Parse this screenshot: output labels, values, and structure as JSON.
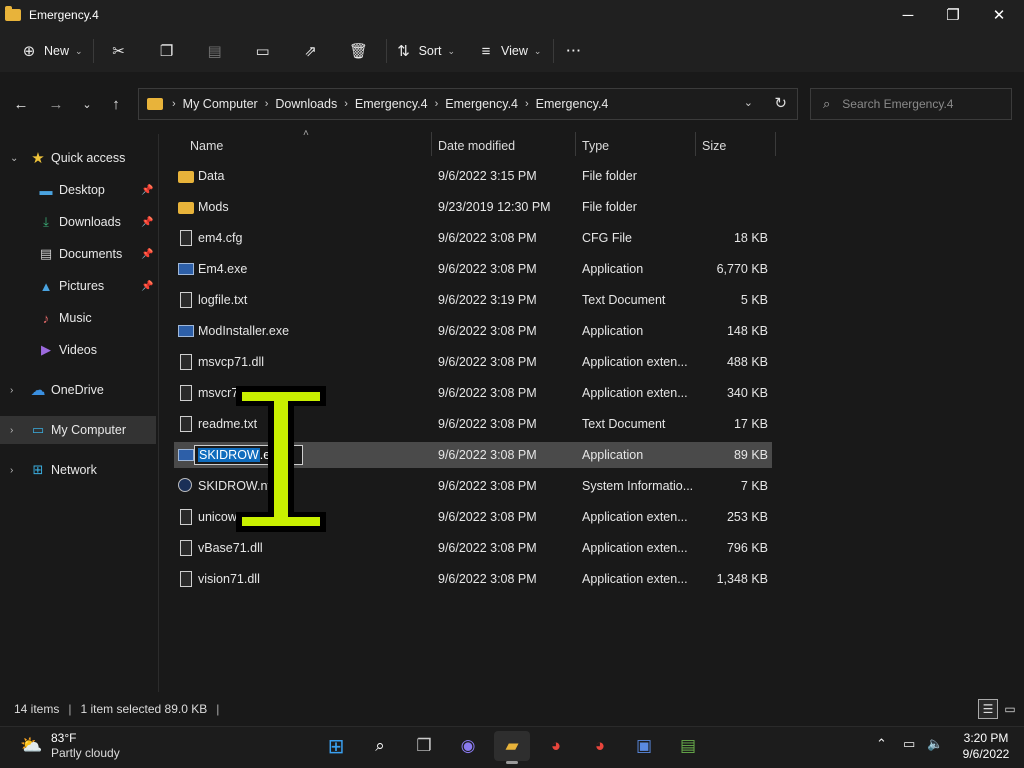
{
  "window": {
    "title": "Emergency.4",
    "controls": {
      "minimize": "─",
      "maximize": "❐",
      "close": "✕"
    }
  },
  "toolbar": {
    "new_label": "New",
    "sort_label": "Sort",
    "view_label": "View",
    "more_label": "···",
    "icons": [
      "cut-icon",
      "copy-icon",
      "paste-icon",
      "rename-icon",
      "share-icon",
      "delete-icon"
    ]
  },
  "address": {
    "breadcrumbs": [
      "My Computer",
      "Downloads",
      "Emergency.4",
      "Emergency.4",
      "Emergency.4"
    ],
    "search_placeholder": "Search Emergency.4"
  },
  "sidebar": {
    "quick_access": "Quick access",
    "quick_items": [
      {
        "label": "Desktop",
        "icon": "desktop-icon"
      },
      {
        "label": "Downloads",
        "icon": "download-icon"
      },
      {
        "label": "Documents",
        "icon": "documents-icon"
      },
      {
        "label": "Pictures",
        "icon": "pictures-icon"
      },
      {
        "label": "Music",
        "icon": "music-icon"
      },
      {
        "label": "Videos",
        "icon": "videos-icon"
      }
    ],
    "onedrive": "OneDrive",
    "mycomputer": "My Computer",
    "network": "Network"
  },
  "columns": {
    "name": "Name",
    "date": "Date modified",
    "type": "Type",
    "size": "Size"
  },
  "files": [
    {
      "name": "Data",
      "date": "9/6/2022 3:15 PM",
      "type": "File folder",
      "size": "",
      "icon": "folder"
    },
    {
      "name": "Mods",
      "date": "9/23/2019 12:30 PM",
      "type": "File folder",
      "size": "",
      "icon": "folder"
    },
    {
      "name": "em4.cfg",
      "date": "9/6/2022 3:08 PM",
      "type": "CFG File",
      "size": "18 KB",
      "icon": "doc"
    },
    {
      "name": "Em4.exe",
      "date": "9/6/2022 3:08 PM",
      "type": "Application",
      "size": "6,770 KB",
      "icon": "app"
    },
    {
      "name": "logfile.txt",
      "date": "9/6/2022 3:19 PM",
      "type": "Text Document",
      "size": "5 KB",
      "icon": "doc"
    },
    {
      "name": "ModInstaller.exe",
      "date": "9/6/2022 3:08 PM",
      "type": "Application",
      "size": "148 KB",
      "icon": "app"
    },
    {
      "name": "msvcp71.dll",
      "date": "9/6/2022 3:08 PM",
      "type": "Application exten...",
      "size": "488 KB",
      "icon": "dll"
    },
    {
      "name": "msvcr7",
      "date": "9/6/2022 3:08 PM",
      "type": "Application exten...",
      "size": "340 KB",
      "icon": "dll"
    },
    {
      "name": "readme.txt",
      "date": "9/6/2022 3:08 PM",
      "type": "Text Document",
      "size": "17 KB",
      "icon": "doc"
    },
    {
      "name": "",
      "date": "9/6/2022 3:08 PM",
      "type": "Application",
      "size": "89 KB",
      "icon": "app"
    },
    {
      "name": "SKIDROW.nfo",
      "date": "9/6/2022 3:08 PM",
      "type": "System Informatio...",
      "size": "7 KB",
      "icon": "nfo"
    },
    {
      "name": "unicow",
      "date": "9/6/2022 3:08 PM",
      "type": "Application exten...",
      "size": "253 KB",
      "icon": "dll"
    },
    {
      "name": "vBase71.dll",
      "date": "9/6/2022 3:08 PM",
      "type": "Application exten...",
      "size": "796 KB",
      "icon": "dll"
    },
    {
      "name": "vision71.dll",
      "date": "9/6/2022 3:08 PM",
      "type": "Application exten...",
      "size": "1,348 KB",
      "icon": "dll"
    }
  ],
  "rename": {
    "selected_text": "SKIDROW",
    "rest_text": ".exe"
  },
  "status": {
    "items": "14 items",
    "selected": "1 item selected  89.0 KB"
  },
  "taskbar": {
    "temp": "83°F",
    "weather": "Partly cloudy",
    "time": "3:20 PM",
    "date": "9/6/2022"
  },
  "colors": {
    "accent": "#0f6cbd",
    "folder": "#e8b33a",
    "cursor": "#c8f000"
  }
}
